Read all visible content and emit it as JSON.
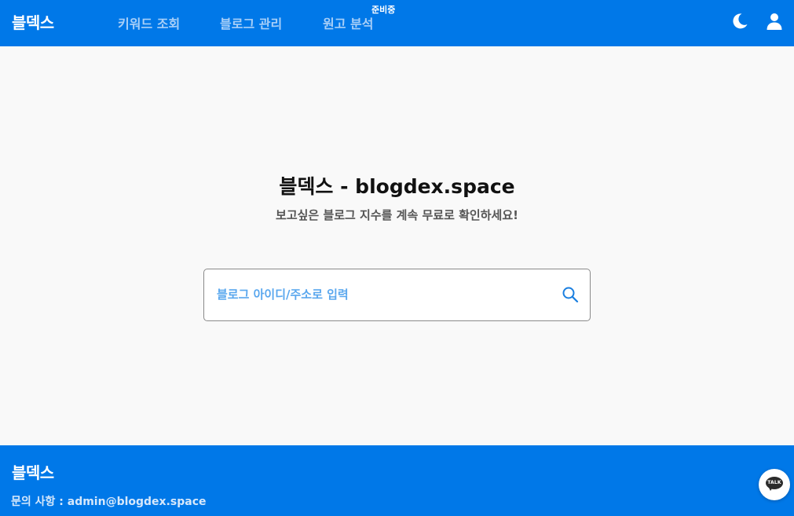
{
  "header": {
    "logo": "블덱스",
    "nav": [
      {
        "label": "키워드 조회"
      },
      {
        "label": "블로그 관리"
      },
      {
        "label": "원고 분석",
        "badge": "준비중"
      }
    ],
    "icons": {
      "theme": "moon-icon",
      "account": "user-icon"
    }
  },
  "main": {
    "title": "블덱스 - blogdex.space",
    "subtitle": "보고싶은 블로그 지수를 계속 무료로 확인하세요!",
    "search": {
      "placeholder": "블로그 아이디/주소로 입력",
      "value": "",
      "icon": "search-icon"
    }
  },
  "footer": {
    "logo": "블덱스",
    "contact": "문의 사항 : admin@blogdex.space"
  },
  "chat": {
    "label": "TALK",
    "icon": "kakaotalk-icon"
  },
  "colors": {
    "brand": "#0078e8",
    "nav_text": "#a8cff8",
    "placeholder": "#5aa7ee",
    "background": "#f9f9f9"
  }
}
